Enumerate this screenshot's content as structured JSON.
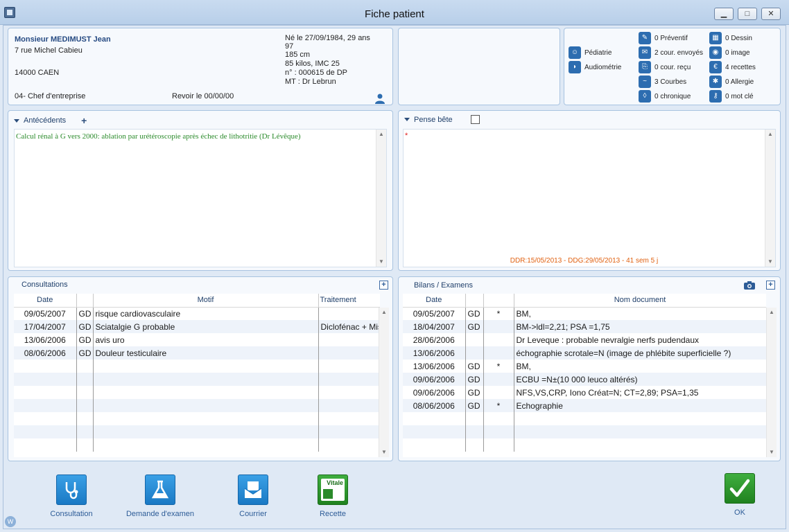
{
  "window": {
    "title": "Fiche patient"
  },
  "patient": {
    "name": "Monsieur MEDIMUST Jean",
    "address1": "7 rue Michel Cabieu",
    "city": "14000 CAEN",
    "profession": "04- Chef d'entreprise",
    "revoir": "Revoir le 00/00/00",
    "birth": "Né le 27/09/1984, 29 ans",
    "line2": "97",
    "height": "185 cm",
    "weight": "85 kilos, IMC 25",
    "number": "n° : 000615 de DP",
    "mt": "MT : Dr Lebrun"
  },
  "flags": {
    "left": [
      {
        "label": "Pédiatrie",
        "icon": "children-icon"
      },
      {
        "label": "Audiométrie",
        "icon": "audio-icon"
      }
    ],
    "mid": [
      {
        "label": "0 Préventif",
        "icon": "syringe-icon"
      },
      {
        "label": "2 cour. envoyés",
        "icon": "mail-icon"
      },
      {
        "label": "0 cour. reçu",
        "icon": "mail-in-icon"
      },
      {
        "label": "3 Courbes",
        "icon": "chart-icon"
      },
      {
        "label": "0 chronique",
        "icon": "pill-icon"
      }
    ],
    "right": [
      {
        "label": "0 Dessin",
        "icon": "drawing-icon"
      },
      {
        "label": "0 image",
        "icon": "image-icon"
      },
      {
        "label": "4 recettes",
        "icon": "euro-icon"
      },
      {
        "label": "0 Allergie",
        "icon": "allergy-icon"
      },
      {
        "label": "0 mot clé",
        "icon": "key-icon"
      }
    ]
  },
  "antecedents": {
    "title": "Antécédents",
    "plus": "+",
    "text": "Calcul rénal  à G vers 2000: ablation par urétéroscopie après échec de lithotritie (Dr Lévêque)"
  },
  "pense": {
    "title": "Pense bête",
    "marker": "*",
    "footer": "DDR:15/05/2013 - DDG:29/05/2013 - 41 sem 5 j"
  },
  "consultations": {
    "title": "Consultations",
    "add": "+",
    "headers": [
      "Date",
      "",
      "Motif",
      "Traitement"
    ],
    "rows": [
      [
        "09/05/2007",
        "GD",
        "risque cardiovasculaire",
        ""
      ],
      [
        "17/04/2007",
        "GD",
        "Sciatalgie G probable",
        "Diclofénac + Mis"
      ],
      [
        "13/06/2006",
        "GD",
        "avis uro",
        ""
      ],
      [
        "08/06/2006",
        "GD",
        "Douleur testiculaire",
        ""
      ]
    ]
  },
  "bilans": {
    "title": "Bilans / Examens",
    "add": "+",
    "headers": [
      "Date",
      "",
      "",
      "Nom document"
    ],
    "rows": [
      [
        "09/05/2007",
        "GD",
        "*",
        "BM,"
      ],
      [
        "18/04/2007",
        "GD",
        "",
        "BM->ldl=2,21; PSA =1,75"
      ],
      [
        "28/06/2006",
        "",
        "",
        "Dr Leveque : probable nevralgie nerfs pudendaux"
      ],
      [
        "13/06/2006",
        "",
        "",
        "échographie scrotale=N (image de  phlébite superficielle ?)"
      ],
      [
        "13/06/2006",
        "GD",
        "*",
        "BM,"
      ],
      [
        "09/06/2006",
        "GD",
        "",
        "ECBU =N±(10 000 leuco altérés)"
      ],
      [
        "09/06/2006",
        "GD",
        "",
        "NFS,VS,CRP, Iono Créat=N; CT=2,89; PSA=1,35"
      ],
      [
        "08/06/2006",
        "GD",
        "*",
        "Echographie"
      ]
    ]
  },
  "actions": {
    "consultation": "Consultation",
    "examen": "Demande d'examen",
    "courrier": "Courrier",
    "recette": "Recette",
    "vitale": "Vitale",
    "ok": "OK",
    "badge": "W"
  },
  "colors": {
    "accent": "#2d6db0",
    "antecedent_text": "#2a8a2a",
    "footer_text": "#e06010"
  }
}
